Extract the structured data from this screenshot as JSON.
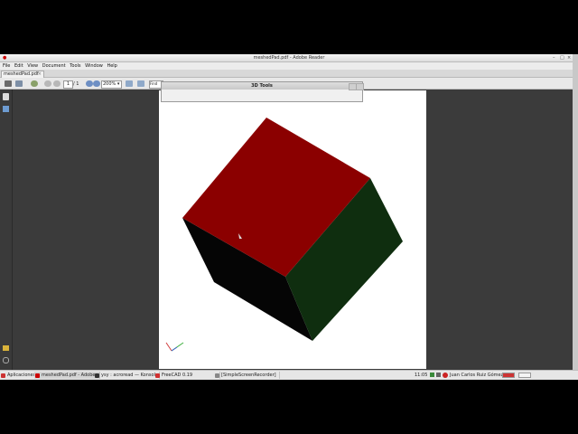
{
  "window": {
    "title": "meshedPad.pdf - Adobe Reader",
    "controls": [
      "–",
      "□",
      "×"
    ]
  },
  "menu": [
    "File",
    "Edit",
    "View",
    "Document",
    "Tools",
    "Window",
    "Help"
  ],
  "tab": {
    "label": "meshedPad.pdf",
    "close": "×"
  },
  "toolbar": {
    "page_current": "1",
    "page_total": "/ 1",
    "zoom": "200%",
    "find_placeholder": "Find"
  },
  "dialog": {
    "title": "3D Tools"
  },
  "model": {
    "colors": {
      "top": "#8b0000",
      "right": "#0f2e0f",
      "left": "#050505"
    }
  },
  "taskbar": {
    "start": "Aplicaciones",
    "tasks": [
      "meshedPad.pdf - Adobe...",
      "ysy : acroread — Konsole",
      "FreeCAD 0.19",
      "[SimpleScreenRecorder]"
    ],
    "clock": "11:05",
    "user": "Juan Carlos Ruiz Gómez"
  }
}
